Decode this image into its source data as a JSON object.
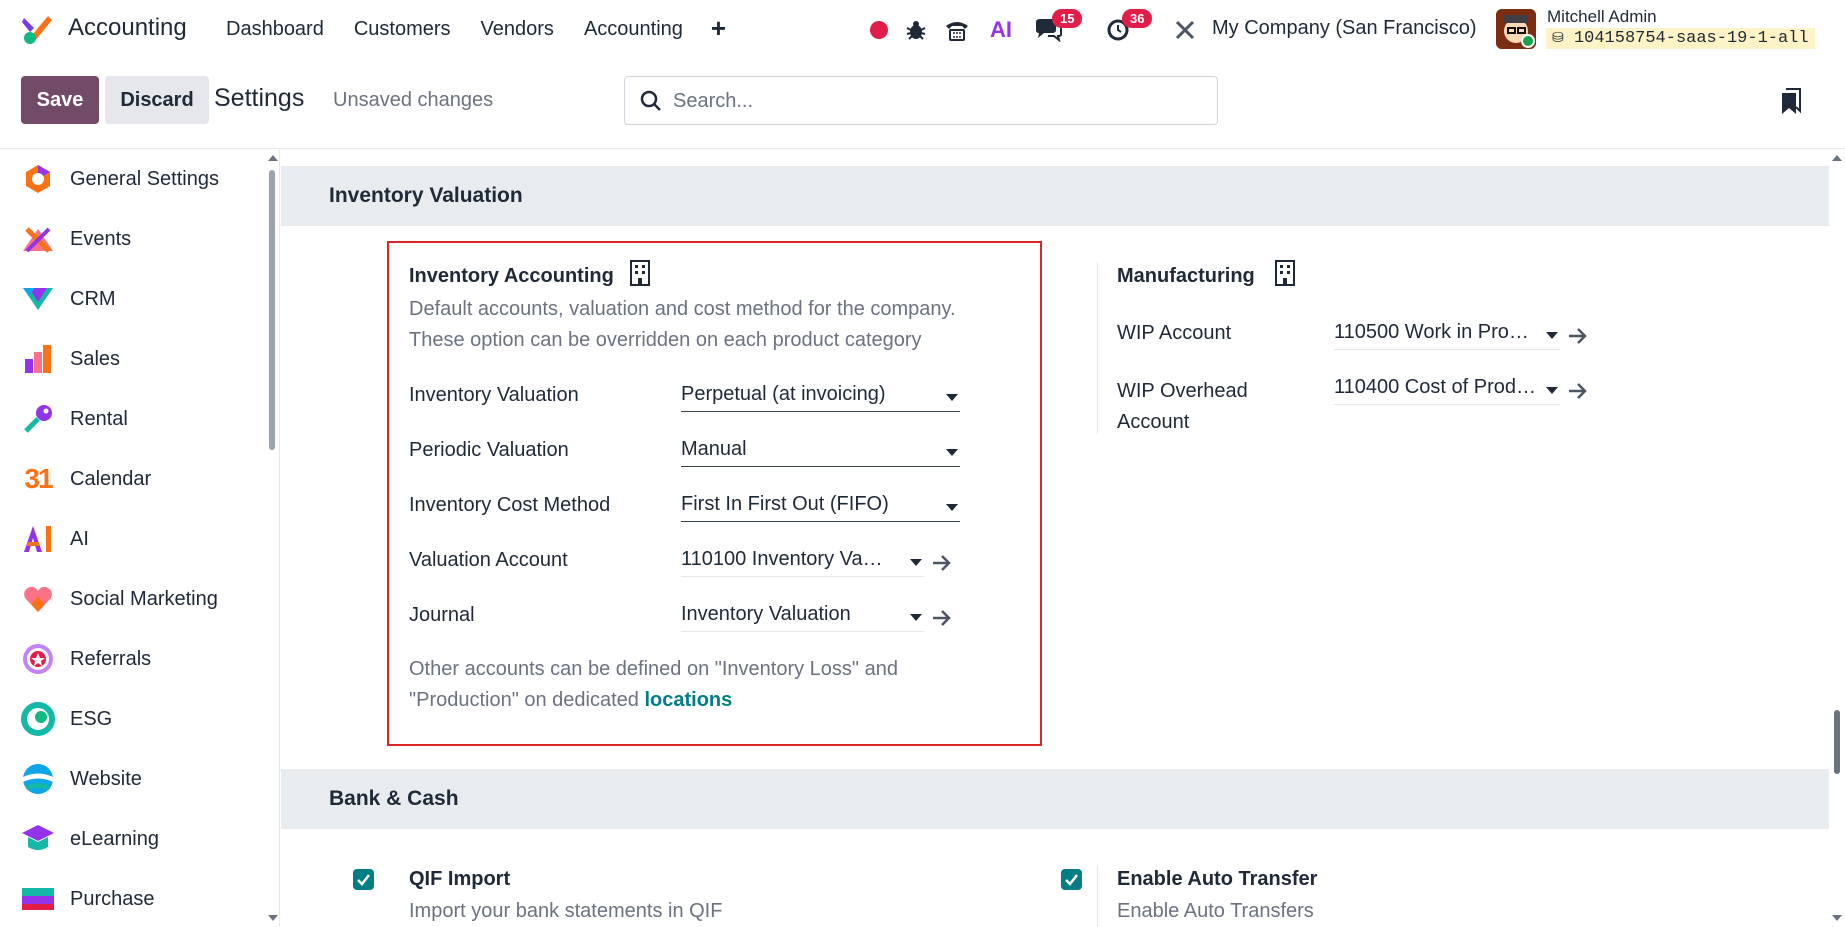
{
  "topbar": {
    "app_name": "Accounting",
    "menu": [
      "Dashboard",
      "Customers",
      "Vendors",
      "Accounting"
    ],
    "plus": "+",
    "ai_label": "AI",
    "chat_badge": "15",
    "activity_badge": "36",
    "company": "My Company (San Francisco)",
    "user_name": "Mitchell Admin",
    "db_name": "104158754-saas-19-1-all"
  },
  "control": {
    "save": "Save",
    "discard": "Discard",
    "title": "Settings",
    "unsaved": "Unsaved changes",
    "search_placeholder": "Search..."
  },
  "sidebar": {
    "items": [
      {
        "label": "General Settings",
        "icon": "general-settings-icon"
      },
      {
        "label": "Events",
        "icon": "events-icon"
      },
      {
        "label": "CRM",
        "icon": "crm-icon"
      },
      {
        "label": "Sales",
        "icon": "sales-icon"
      },
      {
        "label": "Rental",
        "icon": "rental-icon"
      },
      {
        "label": "Calendar",
        "icon": "calendar-icon",
        "icon_text": "31"
      },
      {
        "label": "AI",
        "icon": "ai-icon"
      },
      {
        "label": "Social Marketing",
        "icon": "social-marketing-icon"
      },
      {
        "label": "Referrals",
        "icon": "referrals-icon"
      },
      {
        "label": "ESG",
        "icon": "esg-icon"
      },
      {
        "label": "Website",
        "icon": "website-icon"
      },
      {
        "label": "eLearning",
        "icon": "elearning-icon"
      },
      {
        "label": "Purchase",
        "icon": "purchase-icon"
      }
    ]
  },
  "valuation": {
    "section_title": "Inventory Valuation",
    "inventory_accounting": {
      "title": "Inventory Accounting",
      "desc1": "Default accounts, valuation and cost method for the company.",
      "desc2": "These option can be overridden on each product category",
      "fields": [
        {
          "label": "Inventory Valuation",
          "value": "Perpetual (at invoicing)"
        },
        {
          "label": "Periodic Valuation",
          "value": "Manual"
        },
        {
          "label": "Inventory Cost Method",
          "value": "First In First Out (FIFO)"
        },
        {
          "label": "Valuation Account",
          "value": "110100 Inventory Va…"
        },
        {
          "label": "Journal",
          "value": "Inventory Valuation"
        }
      ],
      "footer1": "Other accounts can be defined on \"Inventory Loss\" and",
      "footer2": "\"Production\" on dedicated ",
      "footer_link": "locations"
    },
    "manufacturing": {
      "title": "Manufacturing",
      "wip_label": "WIP Account",
      "wip_value": "110500 Work in Pro…",
      "overhead_label1": "WIP Overhead",
      "overhead_label2": "Account",
      "overhead_value": "110400 Cost of Prod…"
    }
  },
  "bank": {
    "section_title": "Bank & Cash",
    "qif": {
      "title": "QIF Import",
      "desc": "Import your bank statements in QIF",
      "checked": true
    },
    "auto_transfer": {
      "title": "Enable Auto Transfer",
      "desc": "Enable Auto Transfers",
      "checked": true
    }
  },
  "colors": {
    "primary": "#714b67",
    "accent": "#017e84",
    "highlight_border": "#dc2626",
    "badge": "#e11d48"
  }
}
